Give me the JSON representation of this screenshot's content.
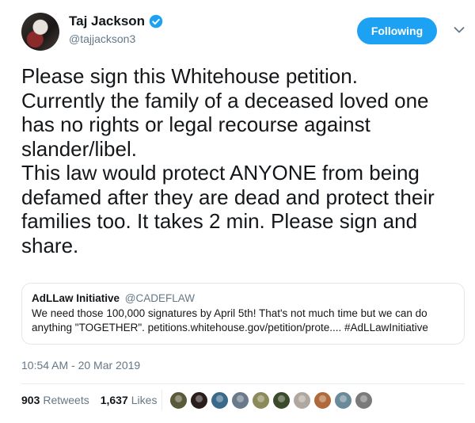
{
  "author": {
    "name": "Taj Jackson",
    "handle": "@tajjackson3",
    "verified": true,
    "verified_icon": "verified-badge-icon",
    "verified_color": "#1da1f2"
  },
  "follow_button": {
    "label": "Following",
    "color": "#1da1f2"
  },
  "menu_icon": "chevron-down-icon",
  "tweet": {
    "text": "Please sign this Whitehouse petition.\nCurrently the family of a deceased loved one has no rights or legal recourse against slander/libel.\nThis law would protect ANYONE from being defamed after they are dead and protect their families too. It takes 2 min. Please sign and share."
  },
  "quoted_tweet": {
    "name": "AdLLaw Initiative",
    "handle": "@CADEFLAW",
    "text": "We need those 100,000 signatures by April 5th! That's not much time but we can do\nanything \"TOGETHER\". petitions.whitehouse.gov/petition/prote.... #AdLLawInitiative"
  },
  "timestamp": "10:54 AM - 20 Mar 2019",
  "stats": {
    "retweets_count": "903",
    "retweets_label": "Retweets",
    "likes_count": "1,637",
    "likes_label": "Likes"
  },
  "liker_avatar_colors": [
    "#5a5a3a",
    "#2a1e1a",
    "#3a6a8a",
    "#6a7a8a",
    "#8a8a5a",
    "#3a4a2a",
    "#b0a8a0",
    "#b06a3a",
    "#6a8a9a",
    "#7a7a7a"
  ]
}
